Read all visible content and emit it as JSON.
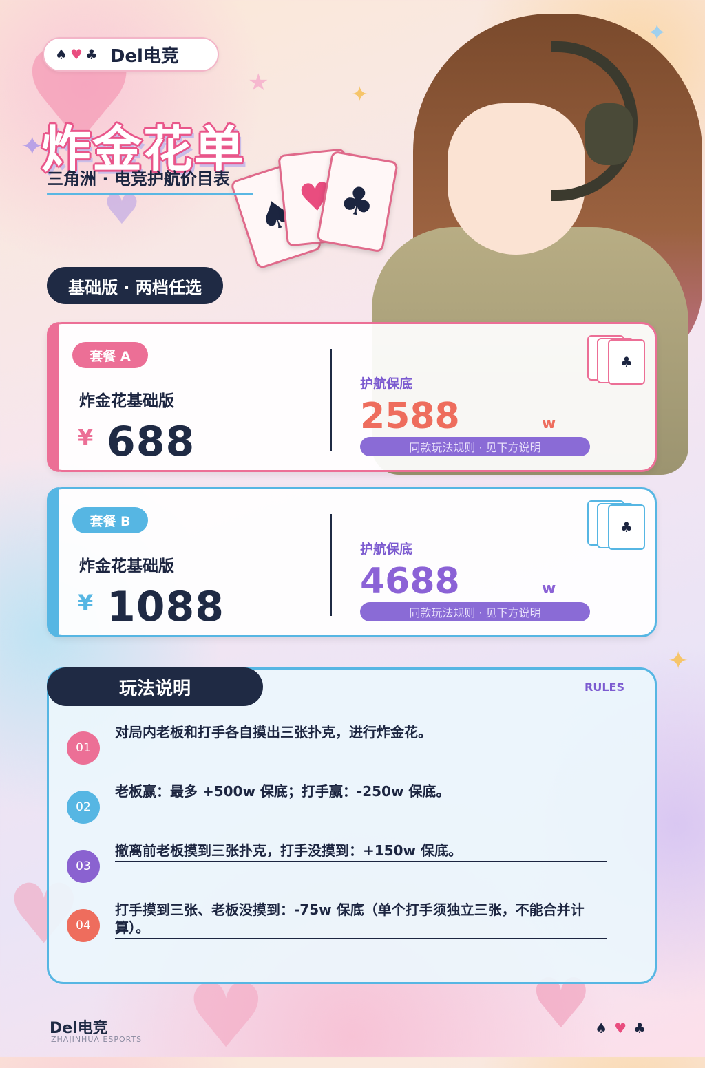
{
  "header": {
    "suits": [
      "♠",
      "♥",
      "♣"
    ],
    "brand": "Del电竞",
    "title": "炸金花单",
    "subtitle": "三角洲 · 电竞护航价目表"
  },
  "section": {
    "label": "基础版 · 两档任选"
  },
  "packages": [
    {
      "tag": "套餐 A",
      "name": "炸金花基础版",
      "currency": "¥",
      "price": "688",
      "guarantee_label": "护航保底",
      "guarantee_value": "2588",
      "guarantee_unit": "w",
      "note": "同款玩法规则 · 见下方说明",
      "card_suit": "♣"
    },
    {
      "tag": "套餐 B",
      "name": "炸金花基础版",
      "currency": "¥",
      "price": "1088",
      "guarantee_label": "护航保底",
      "guarantee_value": "4688",
      "guarantee_unit": "w",
      "note": "同款玩法规则 · 见下方说明",
      "card_suit": "♣"
    }
  ],
  "rules": {
    "title": "玩法说明",
    "title_en": "RULES",
    "items": [
      {
        "num": "01",
        "text": "对局内老板和打手各自摸出三张扑克，进行炸金花。",
        "color": "#ec6f96"
      },
      {
        "num": "02",
        "text": "老板赢：最多 +500w 保底；打手赢：-250w 保底。",
        "color": "#56b6e3"
      },
      {
        "num": "03",
        "text": "撤离前老板摸到三张扑克，打手没摸到：+150w 保底。",
        "color": "#8a62d0"
      },
      {
        "num": "04",
        "text": "打手摸到三张、老板没摸到：-75w 保底（单个打手须独立三张，不能合并计算）。",
        "color": "#ee6d5d"
      }
    ]
  },
  "footer": {
    "brand": "Del电竞",
    "sub": "ZHAJINHUA ESPORTS",
    "suits": [
      "♠",
      "♥",
      "♣"
    ]
  },
  "colors": {
    "navy": "#1f2a44",
    "pink": "#ec6f96",
    "blue": "#56b6e3",
    "purple": "#8a6bd6",
    "coral": "#ee6d5d"
  }
}
